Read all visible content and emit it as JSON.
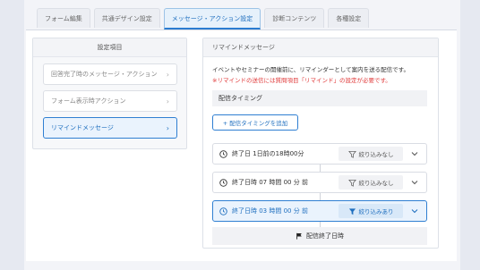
{
  "tabs": [
    {
      "label": "フォーム編集",
      "active": false
    },
    {
      "label": "共通デザイン設定",
      "active": false
    },
    {
      "label": "メッセージ・アクション設定",
      "active": true
    },
    {
      "label": "診断コンテンツ",
      "active": false
    },
    {
      "label": "各種設定",
      "active": false
    }
  ],
  "left_panel": {
    "title": "設定項目",
    "items": [
      {
        "label": "回答完了時のメッセージ・アクション"
      },
      {
        "label": "フォーム表示時アクション"
      },
      {
        "label": "リマインドメッセージ",
        "active": true
      }
    ]
  },
  "right_panel": {
    "title": "リマインドメッセージ",
    "description": "イベントやセミナーの開催前に、リマインダーとして案内を送る配信です。",
    "note": "※リマインドの送信には質問項目「リマインド」の設定が必要です。",
    "timing_label": "配信タイミング",
    "add_button": "+ 配信タイミングを追加",
    "rows": [
      {
        "text": "終了日 1日前の18時00分",
        "filter": "絞り込みなし",
        "active": false
      },
      {
        "text": "終了日時 07 時間 00 分 前",
        "filter": "絞り込みなし",
        "active": false
      },
      {
        "text": "終了日時 03 時間 00 分 前",
        "filter": "絞り込みあり",
        "active": true
      }
    ],
    "end_label": "配信終了日時"
  },
  "colors": {
    "accent": "#2f7fd2",
    "note_red": "#e03a3a"
  }
}
